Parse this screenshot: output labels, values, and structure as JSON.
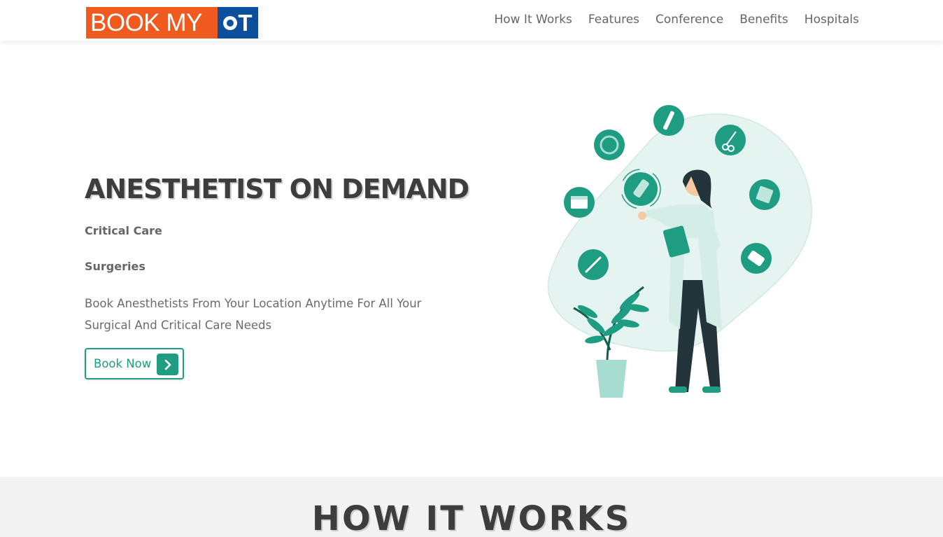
{
  "header": {
    "logo_left": "BOOK MY",
    "logo_right": "T",
    "nav": [
      "How It Works",
      "Features",
      "Conference",
      "Benefits",
      "Hospitals"
    ]
  },
  "hero": {
    "title": "ANESTHETIST ON DEMAND",
    "items": [
      "Critical Care",
      "Surgeries"
    ],
    "description": "Book Anesthetists From Your Location Anytime For All Your Surgical And Critical Care Needs",
    "button_label": "Book Now"
  },
  "section": {
    "title": "HOW IT WORKS"
  },
  "colors": {
    "logo_orange": "#f05a1e",
    "logo_blue": "#0c4f9c",
    "accent_teal": "#1e9d83"
  }
}
